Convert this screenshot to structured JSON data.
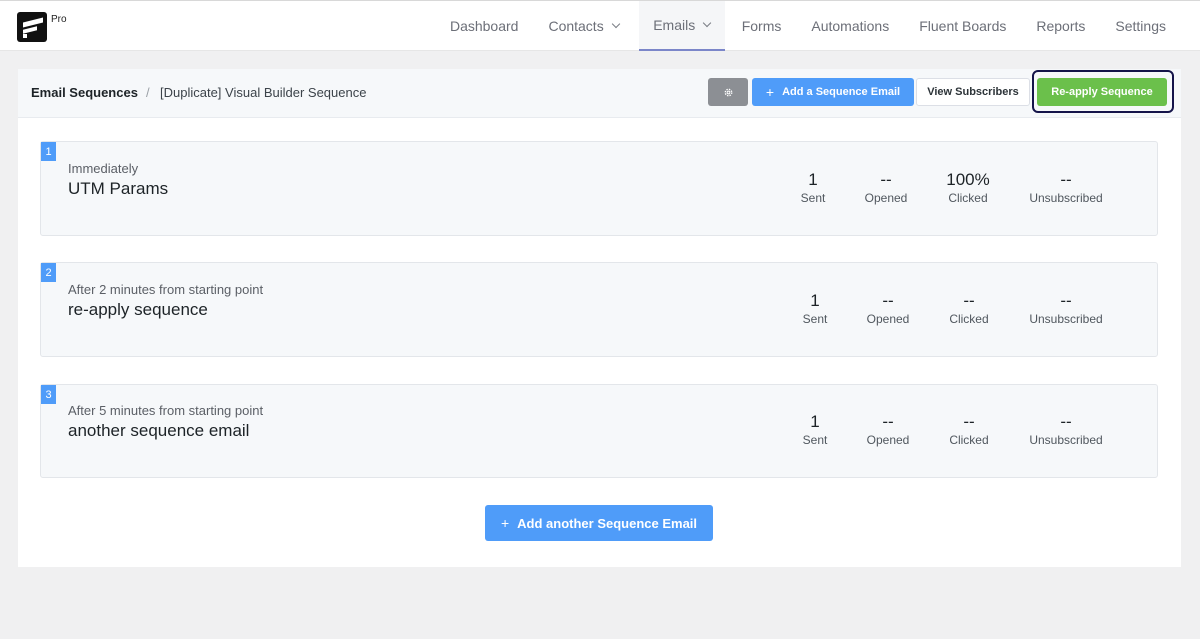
{
  "app": {
    "badge": "Pro"
  },
  "nav": [
    {
      "label": "Dashboard"
    },
    {
      "label": "Contacts"
    },
    {
      "label": "Emails"
    },
    {
      "label": "Forms"
    },
    {
      "label": "Automations"
    },
    {
      "label": "Fluent Boards"
    },
    {
      "label": "Reports"
    },
    {
      "label": "Settings"
    }
  ],
  "breadcrumb": {
    "root": "Email Sequences",
    "separator": "/",
    "current": "[Duplicate] Visual Builder Sequence"
  },
  "toolbar": {
    "settings_icon": "gear-icon",
    "add_label": "Add a Sequence Email",
    "view_label": "View Subscribers",
    "reapply_label": "Re-apply Sequence"
  },
  "stat_labels": {
    "sent": "Sent",
    "opened": "Opened",
    "clicked": "Clicked",
    "unsubscribed": "Unsubscribed"
  },
  "sequences": [
    {
      "index": "1",
      "delay": "Immediately",
      "subject": "UTM Params",
      "sent": "1",
      "opened": "--",
      "clicked": "100%",
      "unsubscribed": "--"
    },
    {
      "index": "2",
      "delay": "After 2 minutes from starting point",
      "subject": "re-apply sequence",
      "sent": "1",
      "opened": "--",
      "clicked": "--",
      "unsubscribed": "--"
    },
    {
      "index": "3",
      "delay": "After 5 minutes from starting point",
      "subject": "another sequence email",
      "sent": "1",
      "opened": "--",
      "clicked": "--",
      "unsubscribed": "--"
    }
  ],
  "add_another_label": "Add another Sequence Email",
  "colors": {
    "primary": "#4f9cf9",
    "success": "#6bc04b",
    "focus": "#15144a"
  }
}
